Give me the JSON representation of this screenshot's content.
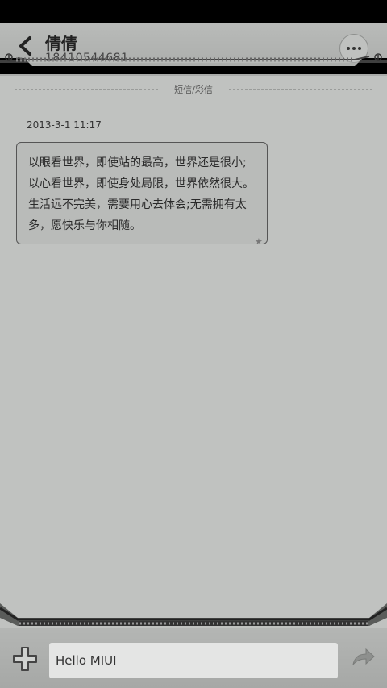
{
  "header": {
    "contact_name": "倩倩",
    "contact_number": "18410544681"
  },
  "divider": {
    "label": "短信/彩信"
  },
  "conversation": {
    "timestamp": "2013-3-1 11:17",
    "messages": [
      {
        "text": "以眼看世界，即使站的最高，世界还是很小;以心看世界，即使身处局限，世界依然很大。生活远不完美，需要用心去体会;无需拥有太多，愿快乐与你相随。",
        "starred": true
      }
    ]
  },
  "composer": {
    "input_value": "Hello MIUI"
  },
  "colors": {
    "background": "#c0c2c0",
    "bubble": "#b9bbb9",
    "header": "#b1b3b1"
  }
}
